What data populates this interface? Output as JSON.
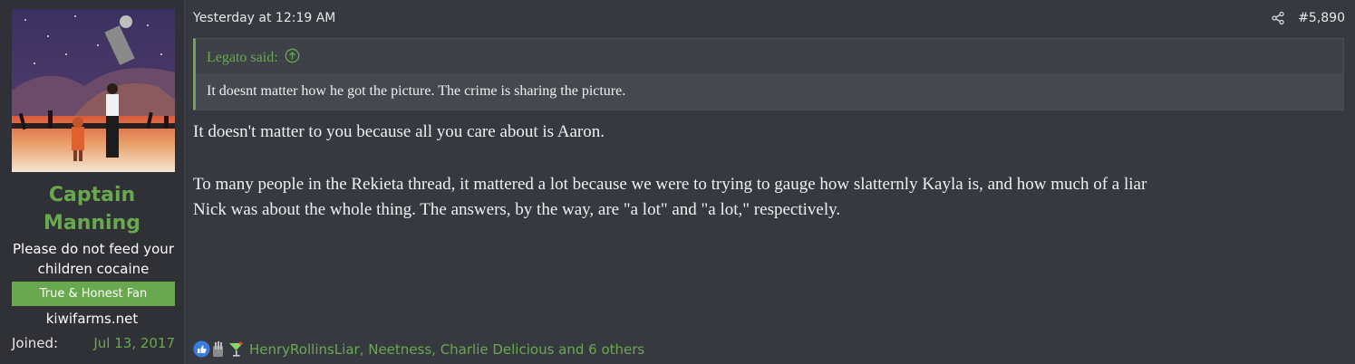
{
  "user": {
    "name_line1": "Captain",
    "name_line2": "Manning",
    "title_line1": "Please do not feed your",
    "title_line2": "children cocaine",
    "banner": "True & Honest Fan",
    "site": "kiwifarms.net",
    "joined_label": "Joined:",
    "joined_date": "Jul 13, 2017"
  },
  "post": {
    "timestamp": "Yesterday at 12:19 AM",
    "number": "#5,890",
    "quote": {
      "attribution": "Legato said:",
      "text": "It doesnt matter how he got the picture. The crime is sharing the picture."
    },
    "paragraph1": "It doesn't matter to you because all you care about is Aaron.",
    "paragraph2_line1": "To many people in the Rekieta thread, it mattered a lot because we were to trying to gauge how slatternly Kayla is, and how much of a liar",
    "paragraph2_line2": "Nick was about the whole thing. The answers, by the way, are \"a lot\" and \"a lot,\" respectively.",
    "reactions": {
      "icons": [
        "like-icon",
        "hand-icon",
        "cocktail-icon"
      ],
      "text": "HenryRollinsLiar, Neetness, Charlie Delicious and 6 others"
    }
  },
  "colors": {
    "accent": "#6aa84f",
    "background": "#363940",
    "sidebar": "#2f3136",
    "quote_bg": "#45484f"
  }
}
